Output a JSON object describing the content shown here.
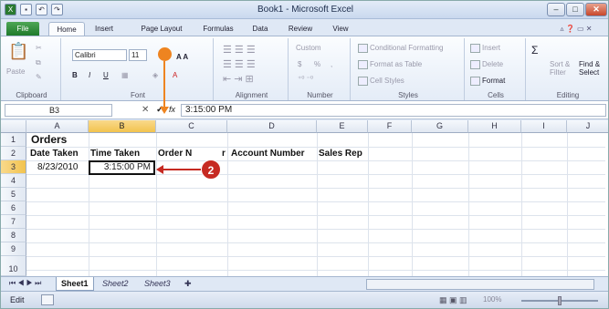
{
  "window": {
    "title": "Book1 - Microsoft Excel",
    "min": "–",
    "max": "□",
    "close": "✕"
  },
  "ribbon_tabs": {
    "file": "File",
    "tabs": [
      "Home",
      "Insert",
      "Page Layout",
      "Formulas",
      "Data",
      "Review",
      "View"
    ]
  },
  "clipboard": {
    "paste": "Paste",
    "label": "Clipboard"
  },
  "font": {
    "name": "Calibri",
    "size": "11",
    "bold": "B",
    "italic": "I",
    "underline": "U",
    "label": "Font"
  },
  "alignment": {
    "label": "Alignment"
  },
  "number": {
    "format": "Custom",
    "dollar": "$",
    "percent": "%",
    "comma": ",",
    "label": "Number"
  },
  "styles": {
    "cond": "Conditional Formatting",
    "table": "Format as Table",
    "cell": "Cell Styles",
    "label": "Styles"
  },
  "cells": {
    "insert": "Insert",
    "delete": "Delete",
    "format": "Format",
    "label": "Cells"
  },
  "editing": {
    "sum": "Σ",
    "sort": "Sort & Filter",
    "find": "Find & Select",
    "label": "Editing"
  },
  "formula_bar": {
    "name_box": "B3",
    "cancel": "✕",
    "enter": "✓",
    "fx": "fx",
    "value": "3:15:00 PM"
  },
  "columns": [
    "A",
    "B",
    "C",
    "D",
    "E",
    "F",
    "G",
    "H",
    "I",
    "J"
  ],
  "rows": [
    "1",
    "2",
    "3",
    "4",
    "5",
    "6",
    "7",
    "8",
    "9",
    "10"
  ],
  "cells_data": {
    "a1": "Orders",
    "a2": "Date Taken",
    "b2": "Time Taken",
    "c2": "Order N",
    "c2b": "r",
    "d2": "Account Number",
    "e2": "Sales Rep",
    "a3": "8/23/2010",
    "b3": "3:15:00 PM"
  },
  "sheets": [
    "Sheet1",
    "Sheet2",
    "Sheet3"
  ],
  "status": {
    "mode": "Edit",
    "zoom": "100%"
  },
  "callout": {
    "number": "2",
    "color": "#c62a22",
    "dot_color": "#ee8420"
  }
}
